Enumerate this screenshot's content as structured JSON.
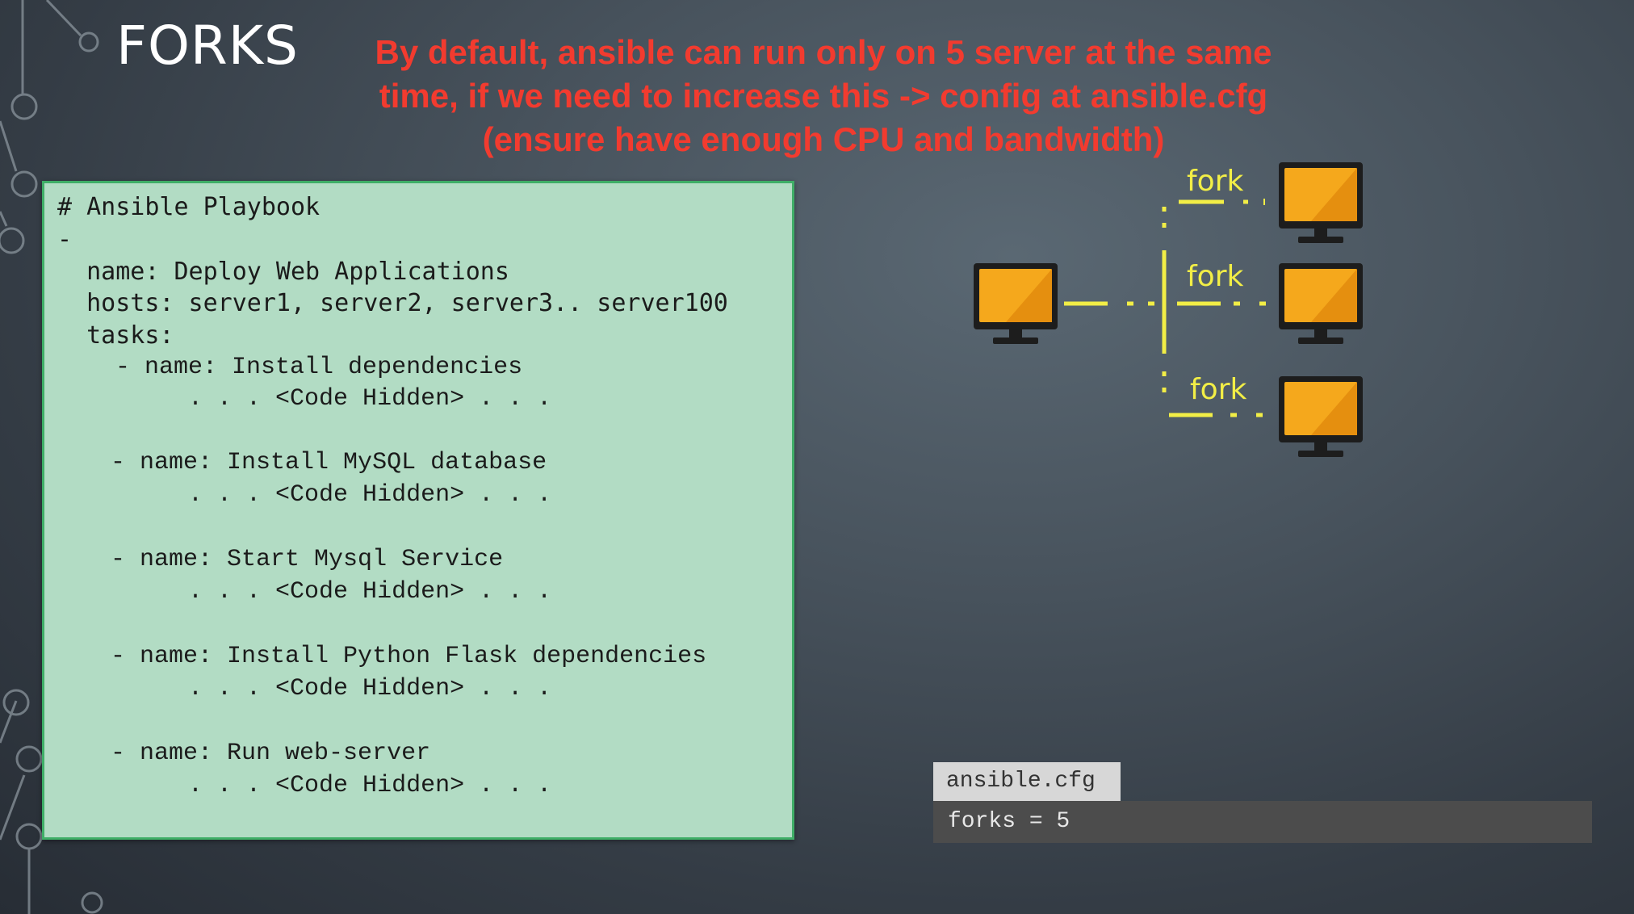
{
  "slide": {
    "title": "FORKS",
    "note_lines": [
      "By default, ansible can run only on 5 server at the same",
      "time, if we need to increase this -> config at ansible.cfg",
      "(ensure have enough CPU and bandwidth)"
    ]
  },
  "playbook": {
    "lines": [
      "# Ansible Playbook",
      "-",
      "  name: Deploy Web Applications",
      "  hosts: server1, server2, server3.. server100",
      "  tasks:",
      "    - name: Install dependencies",
      "         . . . <Code Hidden> . . .",
      "    - name: Install MySQL database",
      "         . . . <Code Hidden> . . .",
      "    - name: Start Mysql Service",
      "         . . . <Code Hidden> . . .",
      "    - name: Install Python Flask dependencies",
      "         . . . <Code Hidden> . . .",
      "    - name: Run web-server",
      "         . . . <Code Hidden> . . ."
    ]
  },
  "diagram": {
    "fork_labels": [
      "fork",
      "fork",
      "fork"
    ],
    "colors": {
      "monitor": "#f5a81c",
      "line": "#f2ee46"
    }
  },
  "config": {
    "filename": "ansible.cfg",
    "content": "forks = 5"
  }
}
